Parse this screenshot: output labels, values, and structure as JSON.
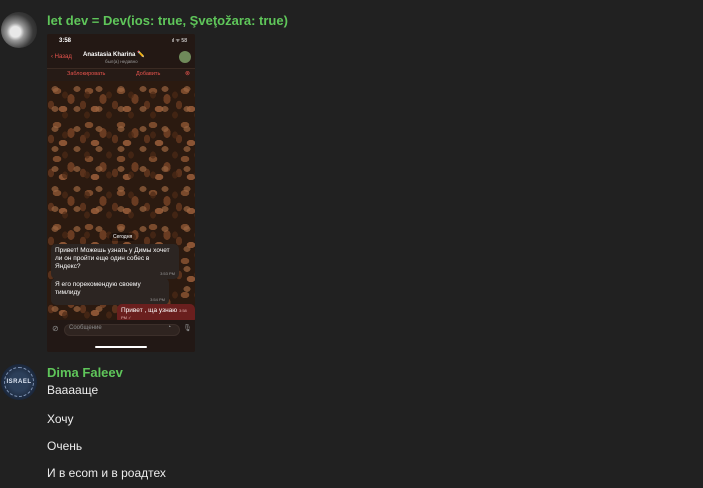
{
  "message1": {
    "sender": "let dev = Dev(ios: true, Şveţožara: true)",
    "screenshot": {
      "time": "3:58",
      "status": "ıl ᯤ 58",
      "back_label": "Назад",
      "contact_name": "Anastasia Kharina ✏️",
      "contact_status": "был(а) недавно",
      "block_label": "Заблокировать",
      "add_label": "Добавить",
      "close_icon": "⊗",
      "date_label": "Сегодня",
      "bubble1_text": "Привет! Можешь узнать у Димы хочет ли он пройти еще один собес в Яндекс?",
      "bubble1_time": "3:53 PM",
      "bubble2_text": "Я его порекомендую своему тимлиду",
      "bubble2_time": "3:54 PM",
      "bubble3_text": "Привет , ща узнаю",
      "bubble3_time": "3:58 PM ✓",
      "input_placeholder": "Сообщение"
    }
  },
  "message2": {
    "sender": "Dima Faleev",
    "avatar_text": "ISRAEL",
    "lines": [
      "Вааааще",
      "Хочу",
      "Очень",
      "И в ecom и в роадтех"
    ]
  },
  "colors": {
    "background": "#212121",
    "sender_name": "#5fc65a",
    "accent_red": "#e9544e"
  }
}
